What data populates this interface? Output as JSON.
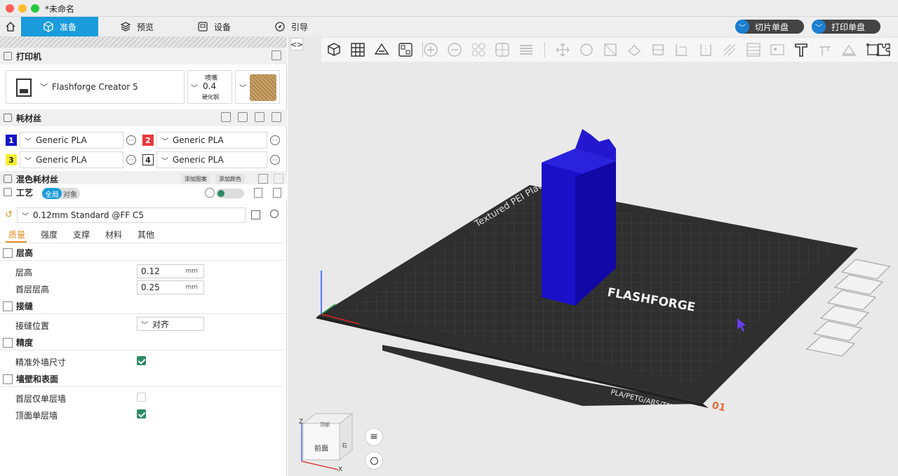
{
  "window": {
    "title": "*未命名"
  },
  "tabs": [
    {
      "label": "准备",
      "icon": "cube-icon",
      "active": true
    },
    {
      "label": "预览",
      "icon": "layers-icon",
      "active": false
    },
    {
      "label": "设备",
      "icon": "device-icon",
      "active": false
    },
    {
      "label": "引导",
      "icon": "compass-icon",
      "active": false
    }
  ],
  "actions": {
    "slice": "切片单盘",
    "print": "打印单盘"
  },
  "printer": {
    "section_title": "打印机",
    "name": "Flashforge Creator 5",
    "nozzle_label": "喷嘴",
    "nozzle_value": "0.4",
    "nozzle_material": "硬化钢"
  },
  "filament": {
    "section_title": "耗材丝",
    "slots": [
      {
        "num": "1",
        "name": "Generic PLA",
        "color": "#1414c8",
        "text_color": "#ffffff"
      },
      {
        "num": "2",
        "name": "Generic PLA",
        "color": "#e8393f",
        "text_color": "#ffffff"
      },
      {
        "num": "3",
        "name": "Generic PLA",
        "color": "#f7ee2f",
        "text_color": "#222222"
      },
      {
        "num": "4",
        "name": "Generic PLA",
        "color": "#ffffff",
        "text_color": "#222222"
      }
    ],
    "mixed_title": "混色耗材丝",
    "add_pattern": "添加图案",
    "add_color": "添加颜色"
  },
  "process": {
    "section_title": "工艺",
    "toggle_global": "全局",
    "toggle_object": "对象",
    "preset": "0.12mm Standard @FF C5",
    "subtabs": [
      "质量",
      "强度",
      "支撑",
      "材料",
      "其他"
    ]
  },
  "quality": {
    "layer_group": "层高",
    "layer_height_label": "层高",
    "layer_height_value": "0.12",
    "first_layer_label": "首层层高",
    "first_layer_value": "0.25",
    "unit": "mm",
    "seam_group": "接缝",
    "seam_pos_label": "接缝位置",
    "seam_pos_value": "对齐",
    "precision_group": "精度",
    "precise_wall_label": "精准外墙尺寸",
    "precise_wall_checked": true,
    "walls_group": "墙壁和表面",
    "first_single_wall_label": "首层仅单层墙",
    "first_single_wall_checked": false,
    "top_single_wall_label": "顶面单层墙",
    "top_single_wall_checked": true
  },
  "scene": {
    "plate_label": "Textured PEI Plate",
    "brand": "FLASHFORGE",
    "materials": "PLA/PETG/ABS/TPU",
    "plate_number": "01",
    "view_cube_front": "前面",
    "view_cube_top": "顶部",
    "view_cube_side": "右",
    "axis_x": "X",
    "axis_z": "Z",
    "model_color": "#1a10c8"
  }
}
